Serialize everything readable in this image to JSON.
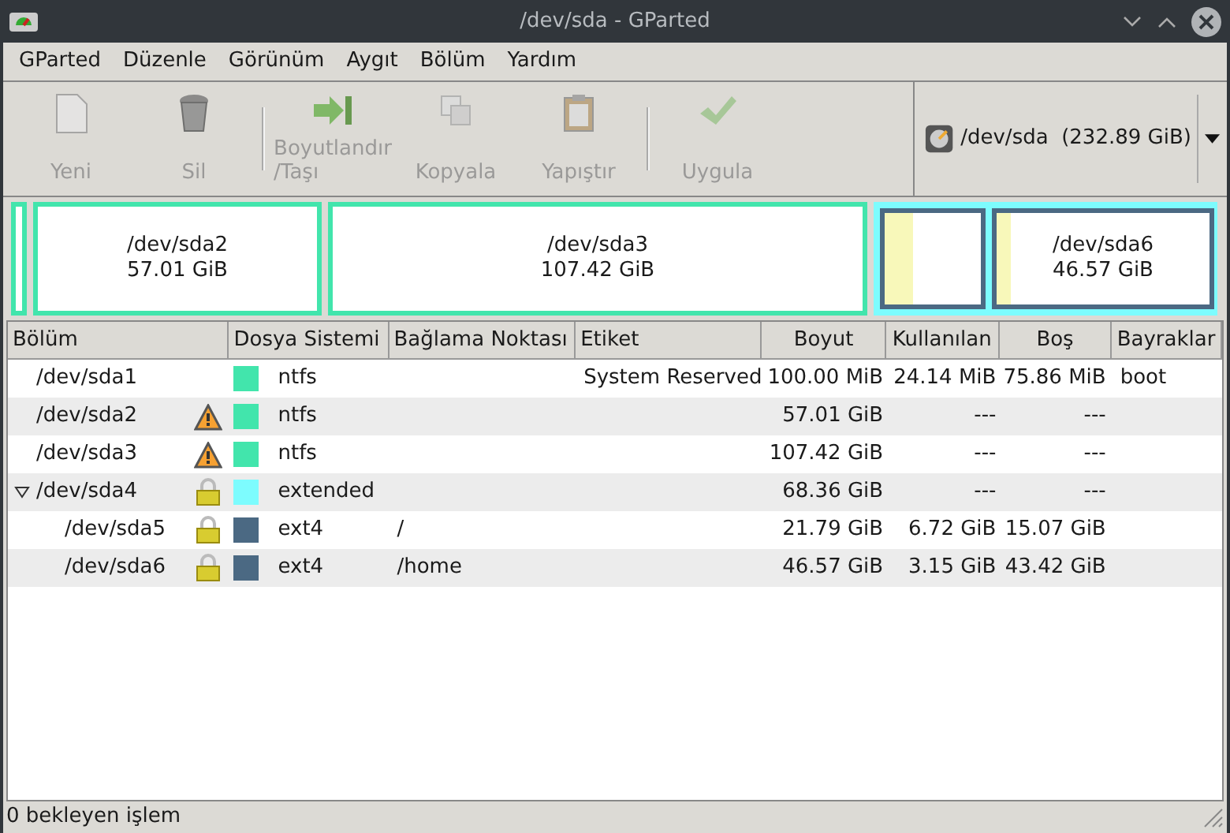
{
  "window": {
    "title": "/dev/sda - GParted"
  },
  "menu": [
    "GParted",
    "Düzenle",
    "Görünüm",
    "Aygıt",
    "Bölüm",
    "Yardım"
  ],
  "toolbar": [
    {
      "kind": "new",
      "label": "Yeni",
      "disabled": true
    },
    {
      "kind": "delete",
      "label": "Sil",
      "disabled": true
    },
    {
      "kind": "resize",
      "label": "Boyutlandır\n/Taşı",
      "disabled": true
    },
    {
      "kind": "copy",
      "label": "Kopyala",
      "disabled": true
    },
    {
      "kind": "paste",
      "label": "Yapıştır",
      "disabled": true
    },
    {
      "kind": "apply",
      "label": "Uygula",
      "disabled": true
    }
  ],
  "device": {
    "name": "/dev/sda",
    "size": "(232.89 GiB)"
  },
  "map": [
    {
      "color": "#42e5ac"
    },
    {
      "label": "/dev/sda2",
      "size": "57.01 GiB",
      "color": "#42e5ac"
    },
    {
      "label": "/dev/sda3",
      "size": "107.42 GiB",
      "color": "#42e5ac"
    },
    {
      "color": "#7dfcfe",
      "children": [
        {
          "color": "#4b6983",
          "level": 0.3
        },
        {
          "label": "/dev/sda6",
          "size": "46.57 GiB",
          "color": "#4b6983",
          "level": 0.07
        }
      ]
    }
  ],
  "table": {
    "columns": [
      "Bölüm",
      "Dosya Sistemi",
      "Bağlama Noktası",
      "Etiket",
      "Boyut",
      "Kullanılan",
      "Boş",
      "Bayraklar"
    ],
    "rows": [
      {
        "name": "/dev/sda1",
        "color": "#42e5ac",
        "fs": "ntfs",
        "label": "System Reserved",
        "size": "100.00 MiB",
        "used": "24.14 MiB",
        "free": "75.86 MiB",
        "flags": "boot"
      },
      {
        "name": "/dev/sda2",
        "kind": "warning",
        "color": "#42e5ac",
        "fs": "ntfs",
        "size": "57.01 GiB",
        "used": "---",
        "free": "---"
      },
      {
        "name": "/dev/sda3",
        "kind": "warning",
        "color": "#42e5ac",
        "fs": "ntfs",
        "size": "107.42 GiB",
        "used": "---",
        "free": "---"
      },
      {
        "name": "/dev/sda4",
        "kind": "locked",
        "color": "#7dfcfe",
        "fs": "extended",
        "size": "68.36 GiB",
        "used": "---",
        "free": "---",
        "expanded": true,
        "children": [
          {
            "name": "/dev/sda5",
            "kind": "locked",
            "color": "#4b6983",
            "fs": "ext4",
            "mount": "/",
            "size": "21.79 GiB",
            "used": "6.72 GiB",
            "free": "15.07 GiB"
          },
          {
            "name": "/dev/sda6",
            "kind": "locked",
            "color": "#4b6983",
            "fs": "ext4",
            "mount": "/home",
            "size": "46.57 GiB",
            "used": "3.15 GiB",
            "free": "43.42 GiB"
          }
        ]
      }
    ]
  },
  "status_bar": "0 bekleyen işlem"
}
